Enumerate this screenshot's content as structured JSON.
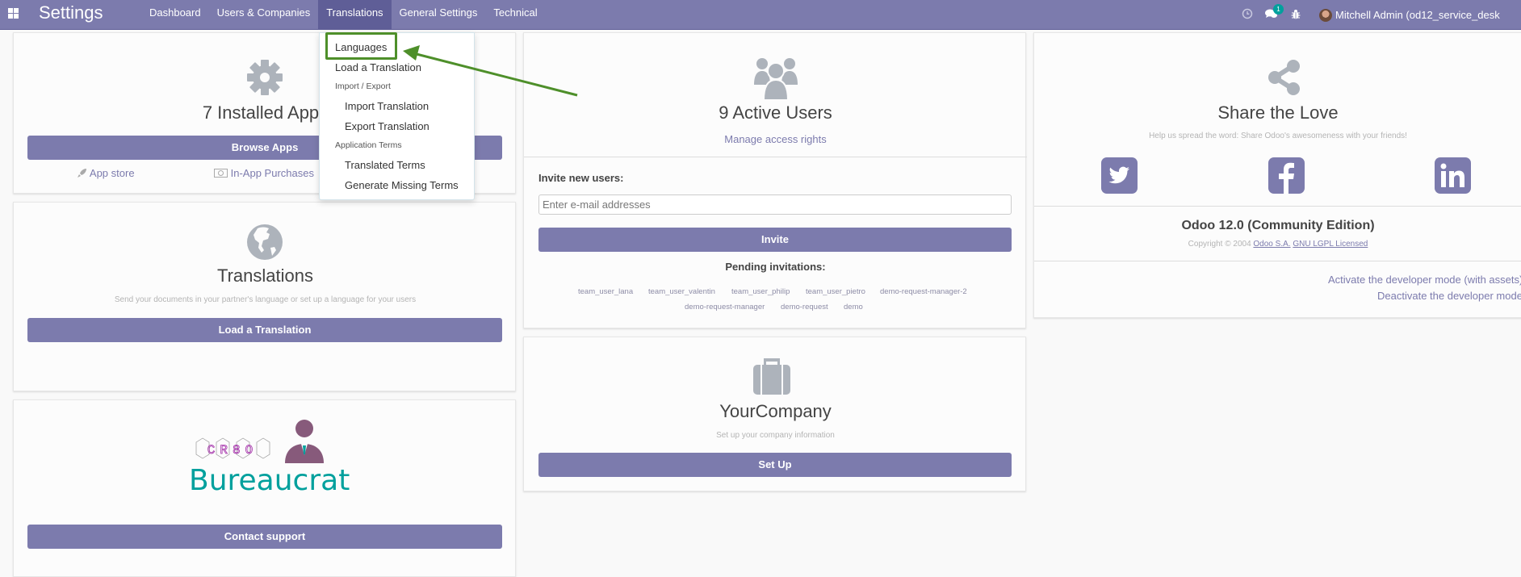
{
  "navbar": {
    "brand": "Settings",
    "menu": [
      "Dashboard",
      "Users & Companies",
      "Translations",
      "General Settings",
      "Technical"
    ],
    "active_menu": "Translations",
    "icons": [
      "clock-icon",
      "chat-icon",
      "bug-icon"
    ],
    "messages_badge": "1",
    "user": "Mitchell Admin (od12_service_desk"
  },
  "dropdown": {
    "items": [
      {
        "label": "Languages",
        "type": "item",
        "highlighted": true
      },
      {
        "label": "Load a Translation",
        "type": "item"
      },
      {
        "label": "Import / Export",
        "type": "header"
      },
      {
        "label": "Import Translation",
        "type": "subitem"
      },
      {
        "label": "Export Translation",
        "type": "subitem"
      },
      {
        "label": "Application Terms",
        "type": "header"
      },
      {
        "label": "Translated Terms",
        "type": "subitem"
      },
      {
        "label": "Generate Missing Terms",
        "type": "subitem"
      }
    ]
  },
  "apps_card": {
    "title": "7 Installed Apps",
    "button": "Browse Apps",
    "links": [
      "App store",
      "In-App Purchases"
    ]
  },
  "translations_card": {
    "title": "Translations",
    "subtitle": "Send your documents in your partner's language or set up a language for your users",
    "button": "Load a Translation"
  },
  "support_card": {
    "logo_text": "Bureaucrat",
    "logo_badge": "CR8O",
    "button": "Contact support"
  },
  "users_card": {
    "title": "9 Active Users",
    "link": "Manage access rights",
    "invite_label": "Invite new users:",
    "email_placeholder": "Enter e-mail addresses",
    "email_value": "",
    "invite_button": "Invite",
    "pending_label": "Pending invitations:",
    "pending": [
      "team_user_lana",
      "team_user_valentin",
      "team_user_philip",
      "team_user_pietro",
      "demo-request-manager-2",
      "demo-request-manager",
      "demo-request",
      "demo"
    ]
  },
  "company_card": {
    "title": "YourCompany",
    "subtitle": "Set up your company information",
    "button": "Set Up"
  },
  "share_card": {
    "title": "Share the Love",
    "subtitle": "Help us spread the word: Share Odoo's awesomeness with your friends!",
    "socials": [
      "twitter",
      "facebook",
      "linkedin"
    ],
    "version": "Odoo 12.0 (Community Edition)",
    "copyright": "Copyright © 2004",
    "company_link": "Odoo S.A.",
    "license_link": "GNU LGPL Licensed",
    "dev_activate": "Activate the developer mode (with assets)",
    "dev_deactivate": "Deactivate the developer mode"
  },
  "colors": {
    "primary": "#7c7bad",
    "annotation": "#4e8f2a",
    "accent_teal": "#00a09d"
  }
}
